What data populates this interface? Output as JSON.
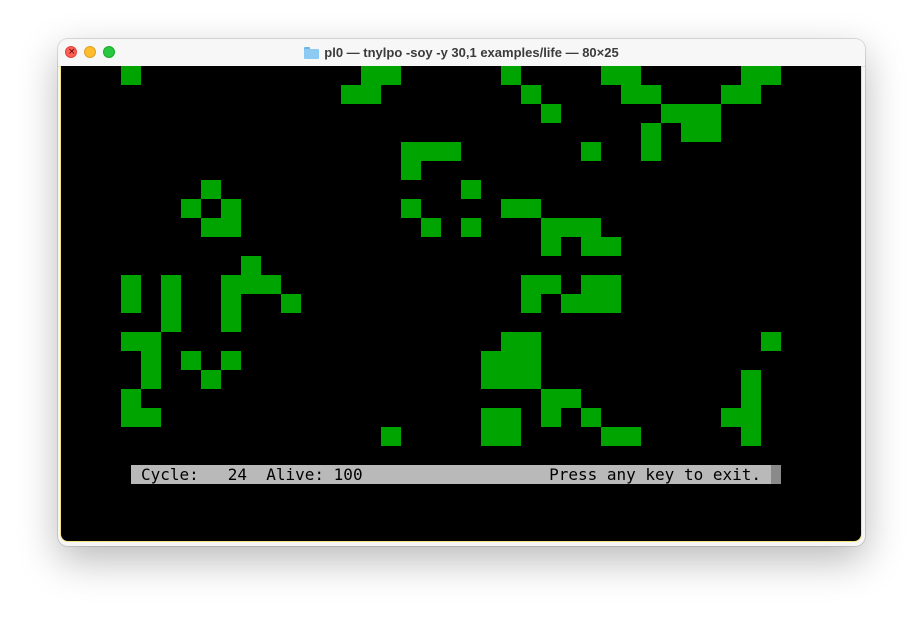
{
  "window": {
    "title": "pl0 — tnylpo -soy -y 30,1 examples/life — 80×25",
    "title_icon": "folder-icon"
  },
  "terminal": {
    "background": "#000000",
    "cell_color": "#00a400",
    "status": {
      "cycle_label": "Cycle:",
      "cycle_value": "24",
      "alive_label": "Alive:",
      "alive_value": "100",
      "message": "Press any key to exit."
    }
  },
  "colors": {
    "close": "#ff5f57",
    "minimize": "#febc2e",
    "maximize": "#28c840",
    "window_border": "#f3e37c",
    "status_bar": "#b9b9b9"
  }
}
